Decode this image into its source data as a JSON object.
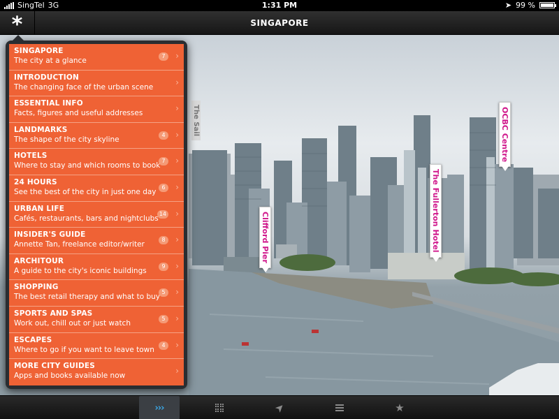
{
  "status_bar": {
    "carrier": "SingTel",
    "network": "3G",
    "time": "1:31 PM",
    "battery": "99 %",
    "battery_level": 0.99
  },
  "nav": {
    "title": "SINGAPORE",
    "menu_icon": "asterisk-icon"
  },
  "photo_labels": {
    "the_sail": "The Sail",
    "ocbc": "OCBC Centre",
    "fullerton": "The Fullerton Hotel",
    "clifford": "Clifford Pier"
  },
  "menu": [
    {
      "title": "SINGAPORE",
      "subtitle": "The city at a glance",
      "count": "7"
    },
    {
      "title": "INTRODUCTION",
      "subtitle": "The changing face of the urban scene",
      "count": ""
    },
    {
      "title": "ESSENTIAL INFO",
      "subtitle": "Facts, figures and useful addresses",
      "count": ""
    },
    {
      "title": "LANDMARKS",
      "subtitle": "The shape of the city skyline",
      "count": "4"
    },
    {
      "title": "HOTELS",
      "subtitle": "Where to stay and which rooms to book",
      "count": "7"
    },
    {
      "title": "24 HOURS",
      "subtitle": "See the best of the city in just one day",
      "count": "6"
    },
    {
      "title": "URBAN LIFE",
      "subtitle": "Cafés, restaurants, bars and nightclubs",
      "count": "14"
    },
    {
      "title": "INSIDER'S GUIDE",
      "subtitle": "Annette Tan, freelance editor/writer",
      "count": "8"
    },
    {
      "title": "ARCHITOUR",
      "subtitle": "A guide to the city's iconic buildings",
      "count": "9"
    },
    {
      "title": "SHOPPING",
      "subtitle": "The best retail therapy and what to buy",
      "count": "5"
    },
    {
      "title": "SPORTS AND SPAS",
      "subtitle": "Work out, chill out or just watch",
      "count": "5"
    },
    {
      "title": "ESCAPES",
      "subtitle": "Where to go if you want to leave town",
      "count": "4"
    },
    {
      "title": "MORE CITY GUIDES",
      "subtitle": "Apps and books available now",
      "count": ""
    }
  ],
  "toolbar": {
    "tabs": [
      {
        "name": "chapters-tab",
        "icon": "chevrons-right-icon",
        "label": "›››",
        "active": true
      },
      {
        "name": "grid-tab",
        "icon": "grid-icon",
        "label": "",
        "active": false
      },
      {
        "name": "map-tab",
        "icon": "location-arrow-icon",
        "label": "➤",
        "active": false
      },
      {
        "name": "list-tab",
        "icon": "list-icon",
        "label": "",
        "active": false
      },
      {
        "name": "favorites-tab",
        "icon": "star-icon",
        "label": "★",
        "active": false
      }
    ]
  },
  "colors": {
    "menu_accent": "#ef6235",
    "poi_text": "#d0188c",
    "active_tab": "#3aa8e8"
  }
}
